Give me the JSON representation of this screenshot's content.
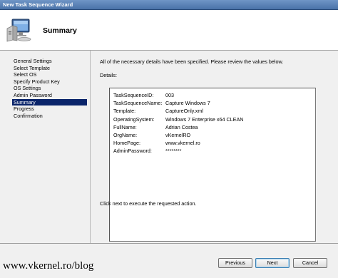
{
  "window": {
    "title": "New Task Sequence Wizard"
  },
  "header": {
    "title": "Summary",
    "icon": "computer-icon"
  },
  "steps": [
    {
      "label": "General Settings",
      "active": false
    },
    {
      "label": "Select Template",
      "active": false
    },
    {
      "label": "Select OS",
      "active": false
    },
    {
      "label": "Specify Product Key",
      "active": false
    },
    {
      "label": "OS Settings",
      "active": false
    },
    {
      "label": "Admin Password",
      "active": false
    },
    {
      "label": "Summary",
      "active": true
    },
    {
      "label": "Progress",
      "active": false
    },
    {
      "label": "Confirmation",
      "active": false
    }
  ],
  "main": {
    "intro": "All of the necessary details have been specified.  Please review the values below.",
    "details_label": "Details:",
    "details": [
      {
        "key": "TaskSequenceID:",
        "value": "003"
      },
      {
        "key": "TaskSequenceName:",
        "value": "Capture Windows 7"
      },
      {
        "key": "Template:",
        "value": "CaptureOnly.xml"
      },
      {
        "key": "OperatingSystem:",
        "value": "Windows 7 Enterprise x64 CLEAN"
      },
      {
        "key": "FullName:",
        "value": "Adrian Costea"
      },
      {
        "key": "OrgName:",
        "value": "vKernelRO"
      },
      {
        "key": "HomePage:",
        "value": "www.vkernel.ro"
      },
      {
        "key": "AdminPassword:",
        "value": "********"
      }
    ],
    "footer_note": "Click next to execute the requested action."
  },
  "buttons": {
    "previous": "Previous",
    "next": "Next",
    "cancel": "Cancel"
  },
  "watermark": "www.vkernel.ro/blog"
}
